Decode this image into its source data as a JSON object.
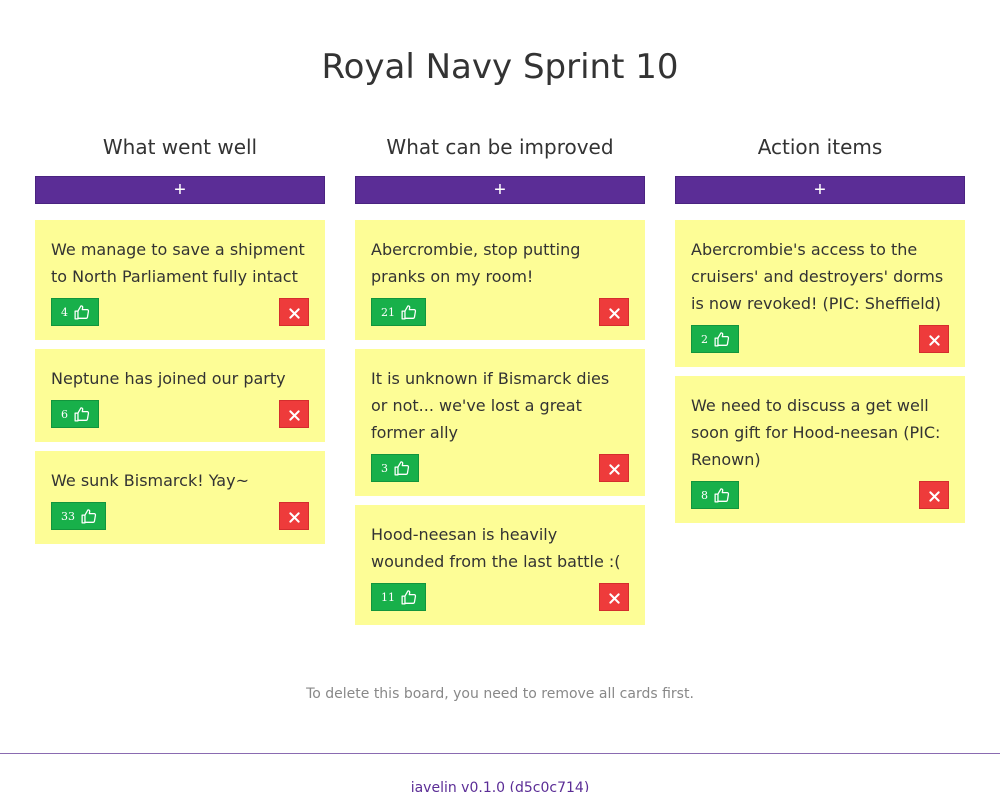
{
  "board": {
    "title": "Royal Navy Sprint 10"
  },
  "columns": [
    {
      "title": "What went well",
      "add_label": "+",
      "cards": [
        {
          "text": "We manage to save a shipment to North Parliament fully intact",
          "votes": "4"
        },
        {
          "text": "Neptune has joined our party",
          "votes": "6"
        },
        {
          "text": "We sunk Bismarck! Yay~",
          "votes": "33"
        }
      ]
    },
    {
      "title": "What can be improved",
      "add_label": "+",
      "cards": [
        {
          "text": "Abercrombie, stop putting pranks on my room!",
          "votes": "21"
        },
        {
          "text": "It is unknown if Bismarck dies or not... we've lost a great former ally",
          "votes": "3"
        },
        {
          "text": "Hood-neesan is heavily wounded from the last battle :(",
          "votes": "11"
        }
      ]
    },
    {
      "title": "Action items",
      "add_label": "+",
      "cards": [
        {
          "text": "Abercrombie's access to the cruisers' and destroyers' dorms is now revoked! (PIC: Sheffield)",
          "votes": "2"
        },
        {
          "text": "We need to discuss a get well soon gift for Hood-neesan (PIC: Renown)",
          "votes": "8"
        }
      ]
    }
  ],
  "notice": "To delete this board, you need to remove all cards first.",
  "footer": {
    "app": "javelin v0.1.0",
    "commit": "(d5c0c714)"
  },
  "colors": {
    "accent": "#5b2d96",
    "card": "#fdfd96",
    "vote": "#18b04a",
    "delete": "#ee3b3b"
  },
  "icons": {
    "vote": "thumbs-up-icon",
    "delete": "close-icon"
  }
}
